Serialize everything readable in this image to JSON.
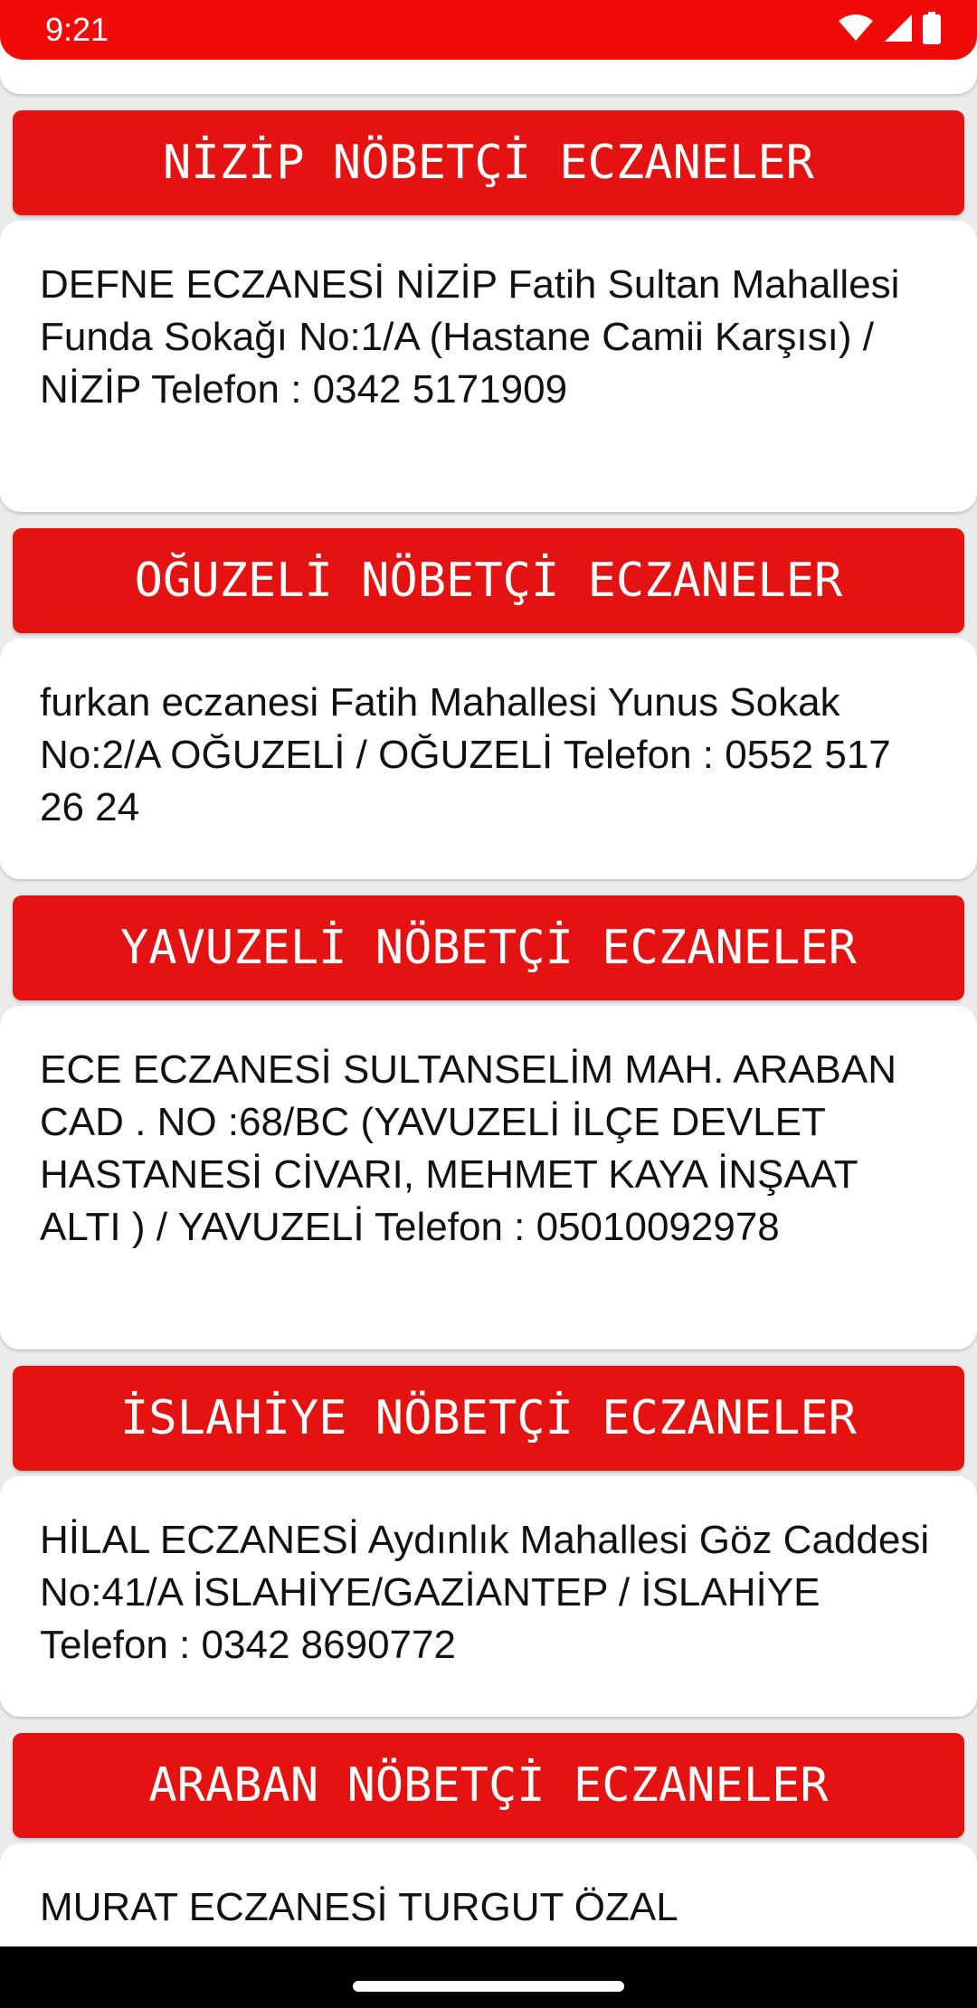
{
  "status_bar": {
    "time": "9:21",
    "icons": [
      "wifi-icon",
      "signal-icon",
      "battery-icon"
    ],
    "color": "#f00a0a"
  },
  "sections": [
    {
      "header": "NİZİP NÖBETÇİ ECZANELER",
      "pharmacy": "DEFNE ECZANESİ NİZİP Fatih Sultan Mahallesi Funda Sokağı No:1/A (Hastane Camii Karşısı) / NİZİP Telefon : 0342 5171909"
    },
    {
      "header": "OĞUZELİ NÖBETÇİ ECZANELER",
      "pharmacy": "furkan eczanesi Fatih Mahallesi Yunus Sokak No:2/A OĞUZELİ / OĞUZELİ Telefon : 0552 517 26 24"
    },
    {
      "header": "YAVUZELİ NÖBETÇİ ECZANELER",
      "pharmacy": "ECE ECZANESİ SULTANSELİM MAH. ARABAN CAD . NO :68/BC (YAVUZELİ İLÇE DEVLET HASTANESİ CİVARI, MEHMET KAYA İNŞAAT ALTI ) / YAVUZELİ Telefon : 05010092978"
    },
    {
      "header": "İSLAHİYE NÖBETÇİ ECZANELER",
      "pharmacy": "HİLAL ECZANESİ Aydınlık Mahallesi Göz Caddesi No:41/A İSLAHİYE/GAZİANTEP / İSLAHİYE Telefon : 0342 8690772"
    },
    {
      "header": "ARABAN NÖBETÇİ ECZANELER",
      "pharmacy": "MURAT ECZANESİ TURGUT ÖZAL"
    }
  ],
  "colors": {
    "header_background": "#e51212",
    "card_background": "#ffffff",
    "page_background": "#ebebeb",
    "text": "#111111"
  }
}
